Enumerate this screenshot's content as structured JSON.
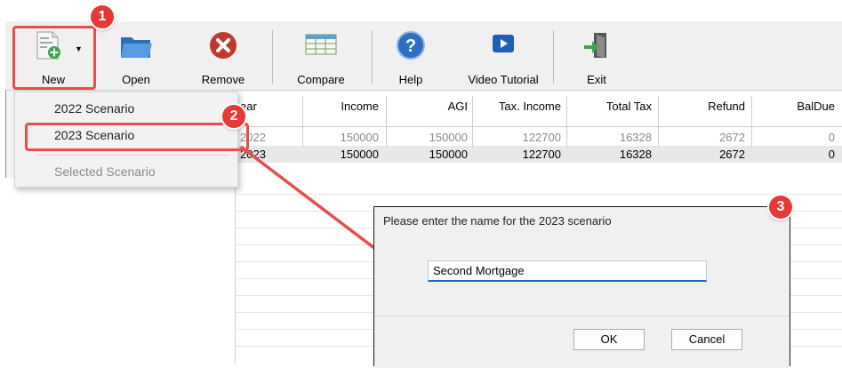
{
  "toolbar": {
    "new_label": "New",
    "open_label": "Open",
    "remove_label": "Remove",
    "compare_label": "Compare",
    "help_label": "Help",
    "video_label": "Video Tutorial",
    "exit_label": "Exit"
  },
  "menu": {
    "items": [
      "2022 Scenario",
      "2023 Scenario"
    ],
    "disabled_item": "Selected Scenario"
  },
  "grid": {
    "headers": [
      "ear",
      "Income",
      "AGI",
      "Tax. Income",
      "Total Tax",
      "Refund",
      "BalDue"
    ],
    "rows": [
      [
        "2022",
        "150000",
        "150000",
        "122700",
        "16328",
        "2672",
        "0"
      ],
      [
        "2023",
        "150000",
        "150000",
        "122700",
        "16328",
        "2672",
        "0"
      ]
    ]
  },
  "dialog": {
    "prompt": "Please enter the name for the 2023 scenario",
    "value": "Second Mortgage",
    "ok_label": "OK",
    "cancel_label": "Cancel"
  },
  "callouts": [
    "1",
    "2",
    "3"
  ],
  "colors": {
    "accent_red": "#e53935",
    "input_focus": "#1e63c4"
  }
}
